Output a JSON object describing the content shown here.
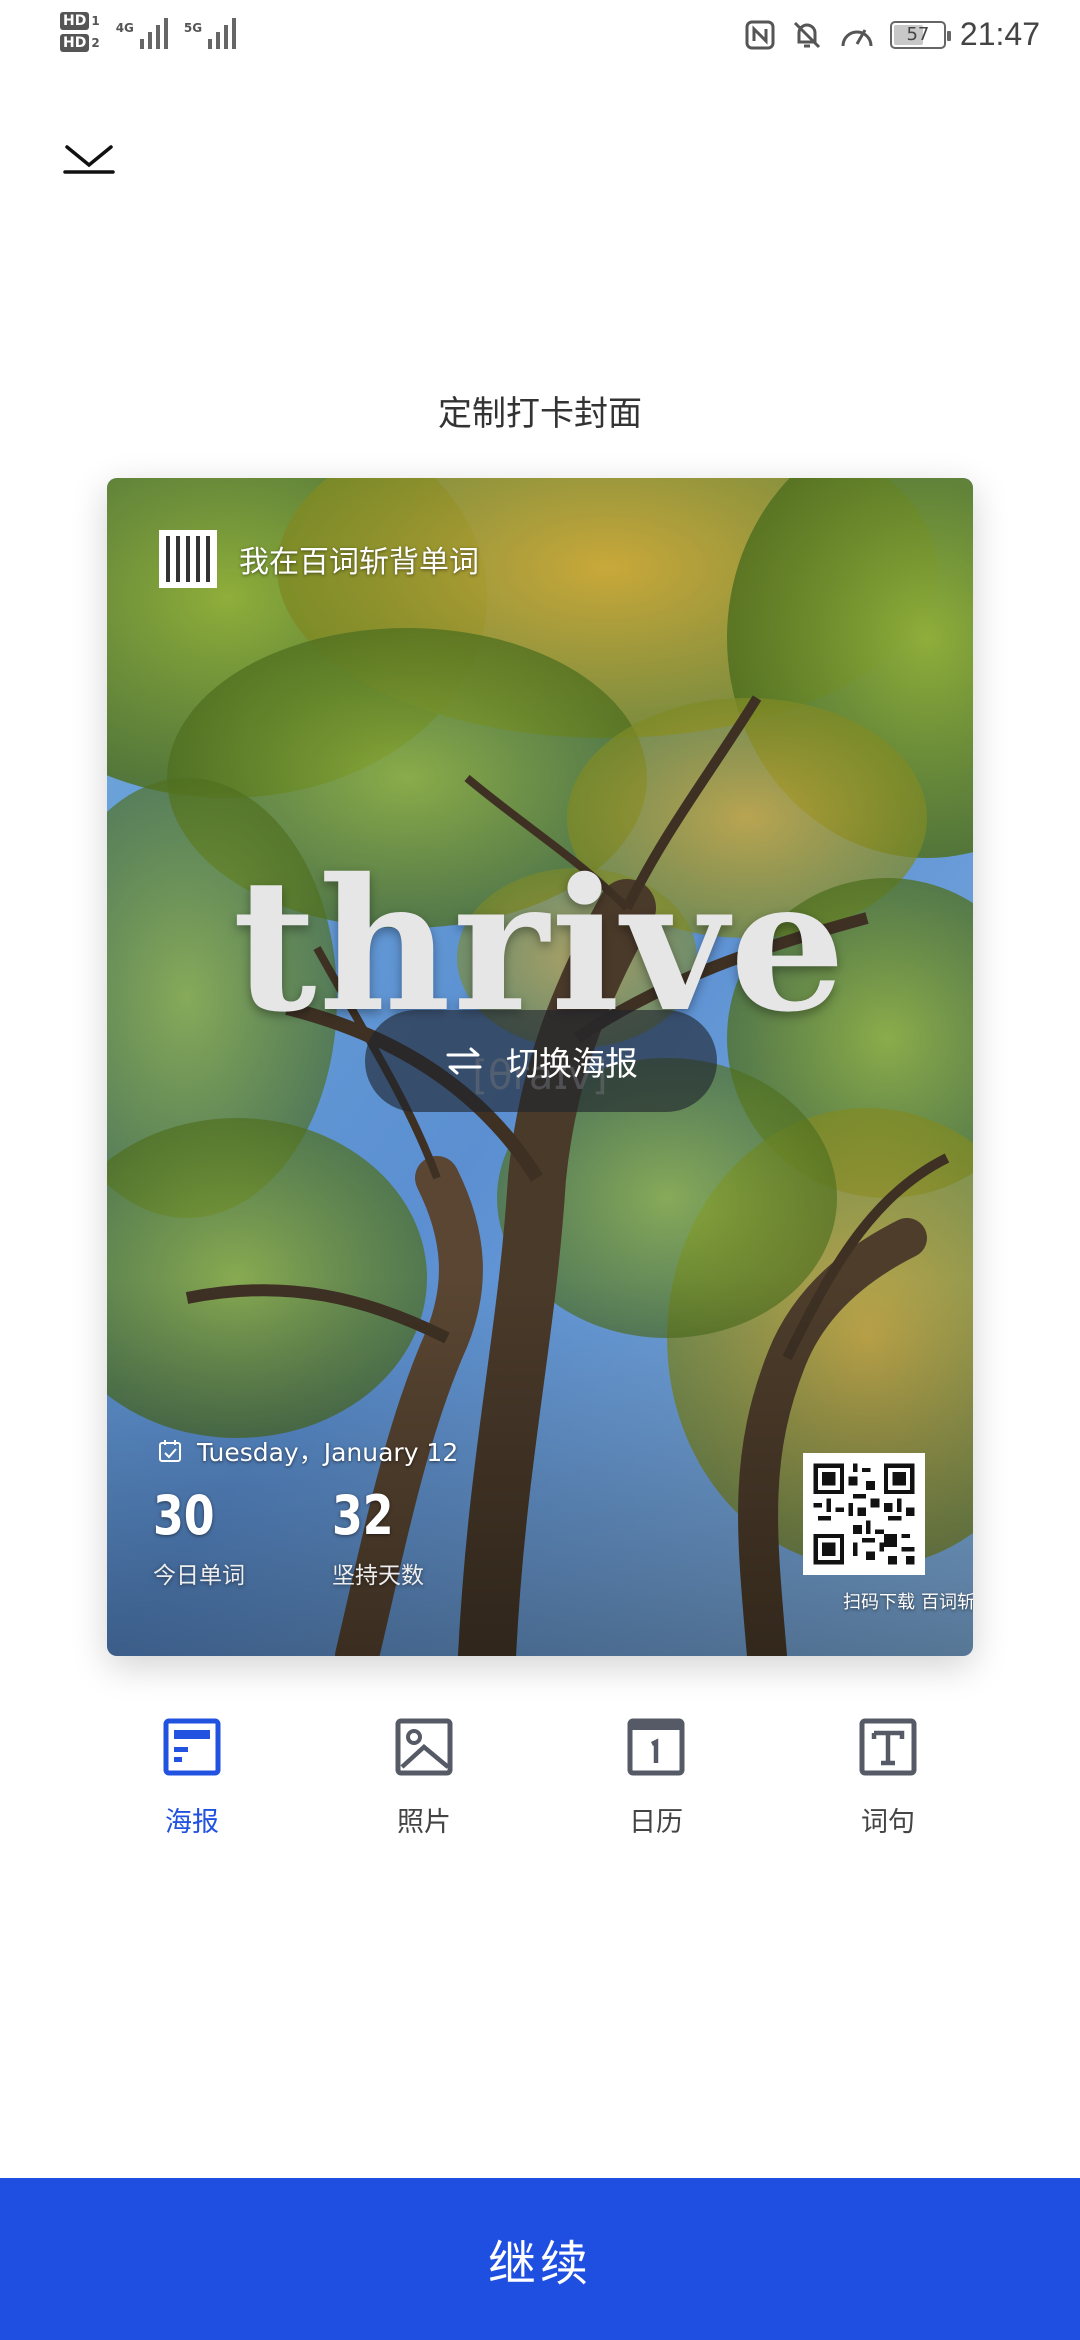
{
  "status_bar": {
    "hd1": "HD",
    "hd1_sub": "1",
    "hd2": "HD",
    "hd2_sub": "2",
    "net1": "4G",
    "net2": "5G",
    "battery_level": "57",
    "time": "21:47",
    "icons": [
      "nfc-icon",
      "bell-muted-icon",
      "speed-icon",
      "battery-icon"
    ]
  },
  "header": {
    "close_icon": "chevron-down-icon",
    "title": "定制打卡封面"
  },
  "poster": {
    "brand_text": "我在百词斩背单词",
    "word": "thrive",
    "phonetic": "[θraɪv]",
    "switch_label": "切换海报",
    "date": "Tuesday，January 12",
    "today_words": "30",
    "today_words_label": "今日单词",
    "streak_days": "32",
    "streak_days_label": "坚持天数",
    "qr_caption_left": "扫码下载",
    "qr_caption_right": "百词斩"
  },
  "tabs": [
    {
      "label": "海报",
      "icon": "poster-icon",
      "active": true
    },
    {
      "label": "照片",
      "icon": "photo-icon",
      "active": false
    },
    {
      "label": "日历",
      "icon": "calendar-icon",
      "active": false
    },
    {
      "label": "词句",
      "icon": "text-icon",
      "active": false
    }
  ],
  "colors": {
    "accent": "#1f4fe0",
    "tab_active": "#2152e0",
    "tab_inactive": "#555a66"
  },
  "footer": {
    "continue_label": "继续"
  }
}
